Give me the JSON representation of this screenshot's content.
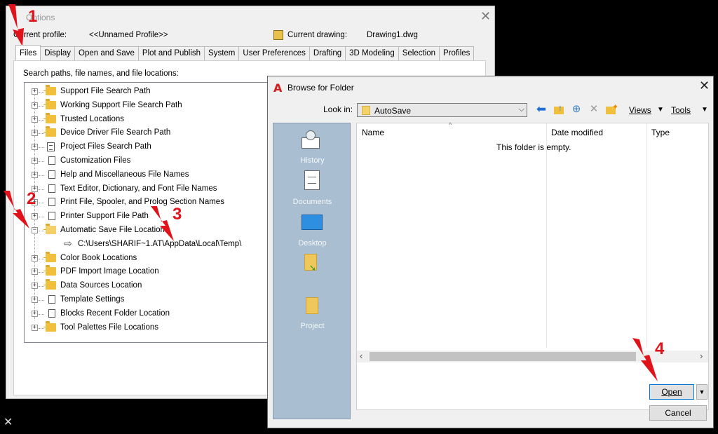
{
  "options": {
    "title": "Options",
    "current_profile_label": "Current profile:",
    "current_profile_value": "<<Unnamed Profile>>",
    "current_drawing_label": "Current drawing:",
    "current_drawing_value": "Drawing1.dwg",
    "tabs": [
      "Files",
      "Display",
      "Open and Save",
      "Plot and Publish",
      "System",
      "User Preferences",
      "Drafting",
      "3D Modeling",
      "Selection",
      "Profiles"
    ],
    "active_tab": "Files",
    "panel_caption": "Search paths, file names, and file locations:",
    "tree": [
      {
        "label": "Support File Search Path",
        "icon": "folder-icon",
        "expander": "+"
      },
      {
        "label": "Working Support File Search Path",
        "icon": "folder-icon",
        "expander": "+"
      },
      {
        "label": "Trusted Locations",
        "icon": "folder-icon",
        "expander": "+"
      },
      {
        "label": "Device Driver File Search Path",
        "icon": "folder-icon",
        "expander": "+"
      },
      {
        "label": "Project Files Search Path",
        "icon": "document-icon",
        "expander": "+"
      },
      {
        "label": "Customization Files",
        "icon": "files-icon",
        "expander": "+"
      },
      {
        "label": "Help and Miscellaneous File Names",
        "icon": "files-icon",
        "expander": "+"
      },
      {
        "label": "Text Editor, Dictionary, and Font File Names",
        "icon": "files-icon",
        "expander": "+"
      },
      {
        "label": "Print File, Spooler, and Prolog Section Names",
        "icon": "files-icon",
        "expander": "+"
      },
      {
        "label": "Printer Support File Path",
        "icon": "files-icon",
        "expander": "+"
      },
      {
        "label": "Automatic Save File Location",
        "icon": "folder-open-icon",
        "expander": "-"
      },
      {
        "label": "Color Book Locations",
        "icon": "folder-icon",
        "expander": "+"
      },
      {
        "label": "PDF Import Image Location",
        "icon": "folder-icon",
        "expander": "+"
      },
      {
        "label": "Data Sources Location",
        "icon": "folder-icon",
        "expander": "+"
      },
      {
        "label": "Template Settings",
        "icon": "files-icon",
        "expander": "+"
      },
      {
        "label": "Blocks Recent Folder Location",
        "icon": "files-icon",
        "expander": "+"
      },
      {
        "label": "Tool Palettes File Locations",
        "icon": "folder-icon",
        "expander": "+"
      }
    ],
    "autosave_path": "C:\\Users\\SHARIF~1.AT\\AppData\\Local\\Temp\\"
  },
  "browse": {
    "title": "Browse for Folder",
    "look_in_label": "Look in:",
    "look_in_value": "AutoSave",
    "views_label": "Views",
    "tools_label": "Tools",
    "places": [
      "History",
      "Documents",
      "Desktop",
      "",
      "Project"
    ],
    "columns": [
      "Name",
      "Date modified",
      "Type"
    ],
    "empty_message": "This folder is empty.",
    "open_button": "Open",
    "cancel_button": "Cancel"
  },
  "annotations": [
    "1",
    "2",
    "3",
    "4"
  ],
  "colors": {
    "annotation": "#e0131b",
    "places_bar": "#a9bed0",
    "dialog_bg": "#f0f0f0"
  }
}
